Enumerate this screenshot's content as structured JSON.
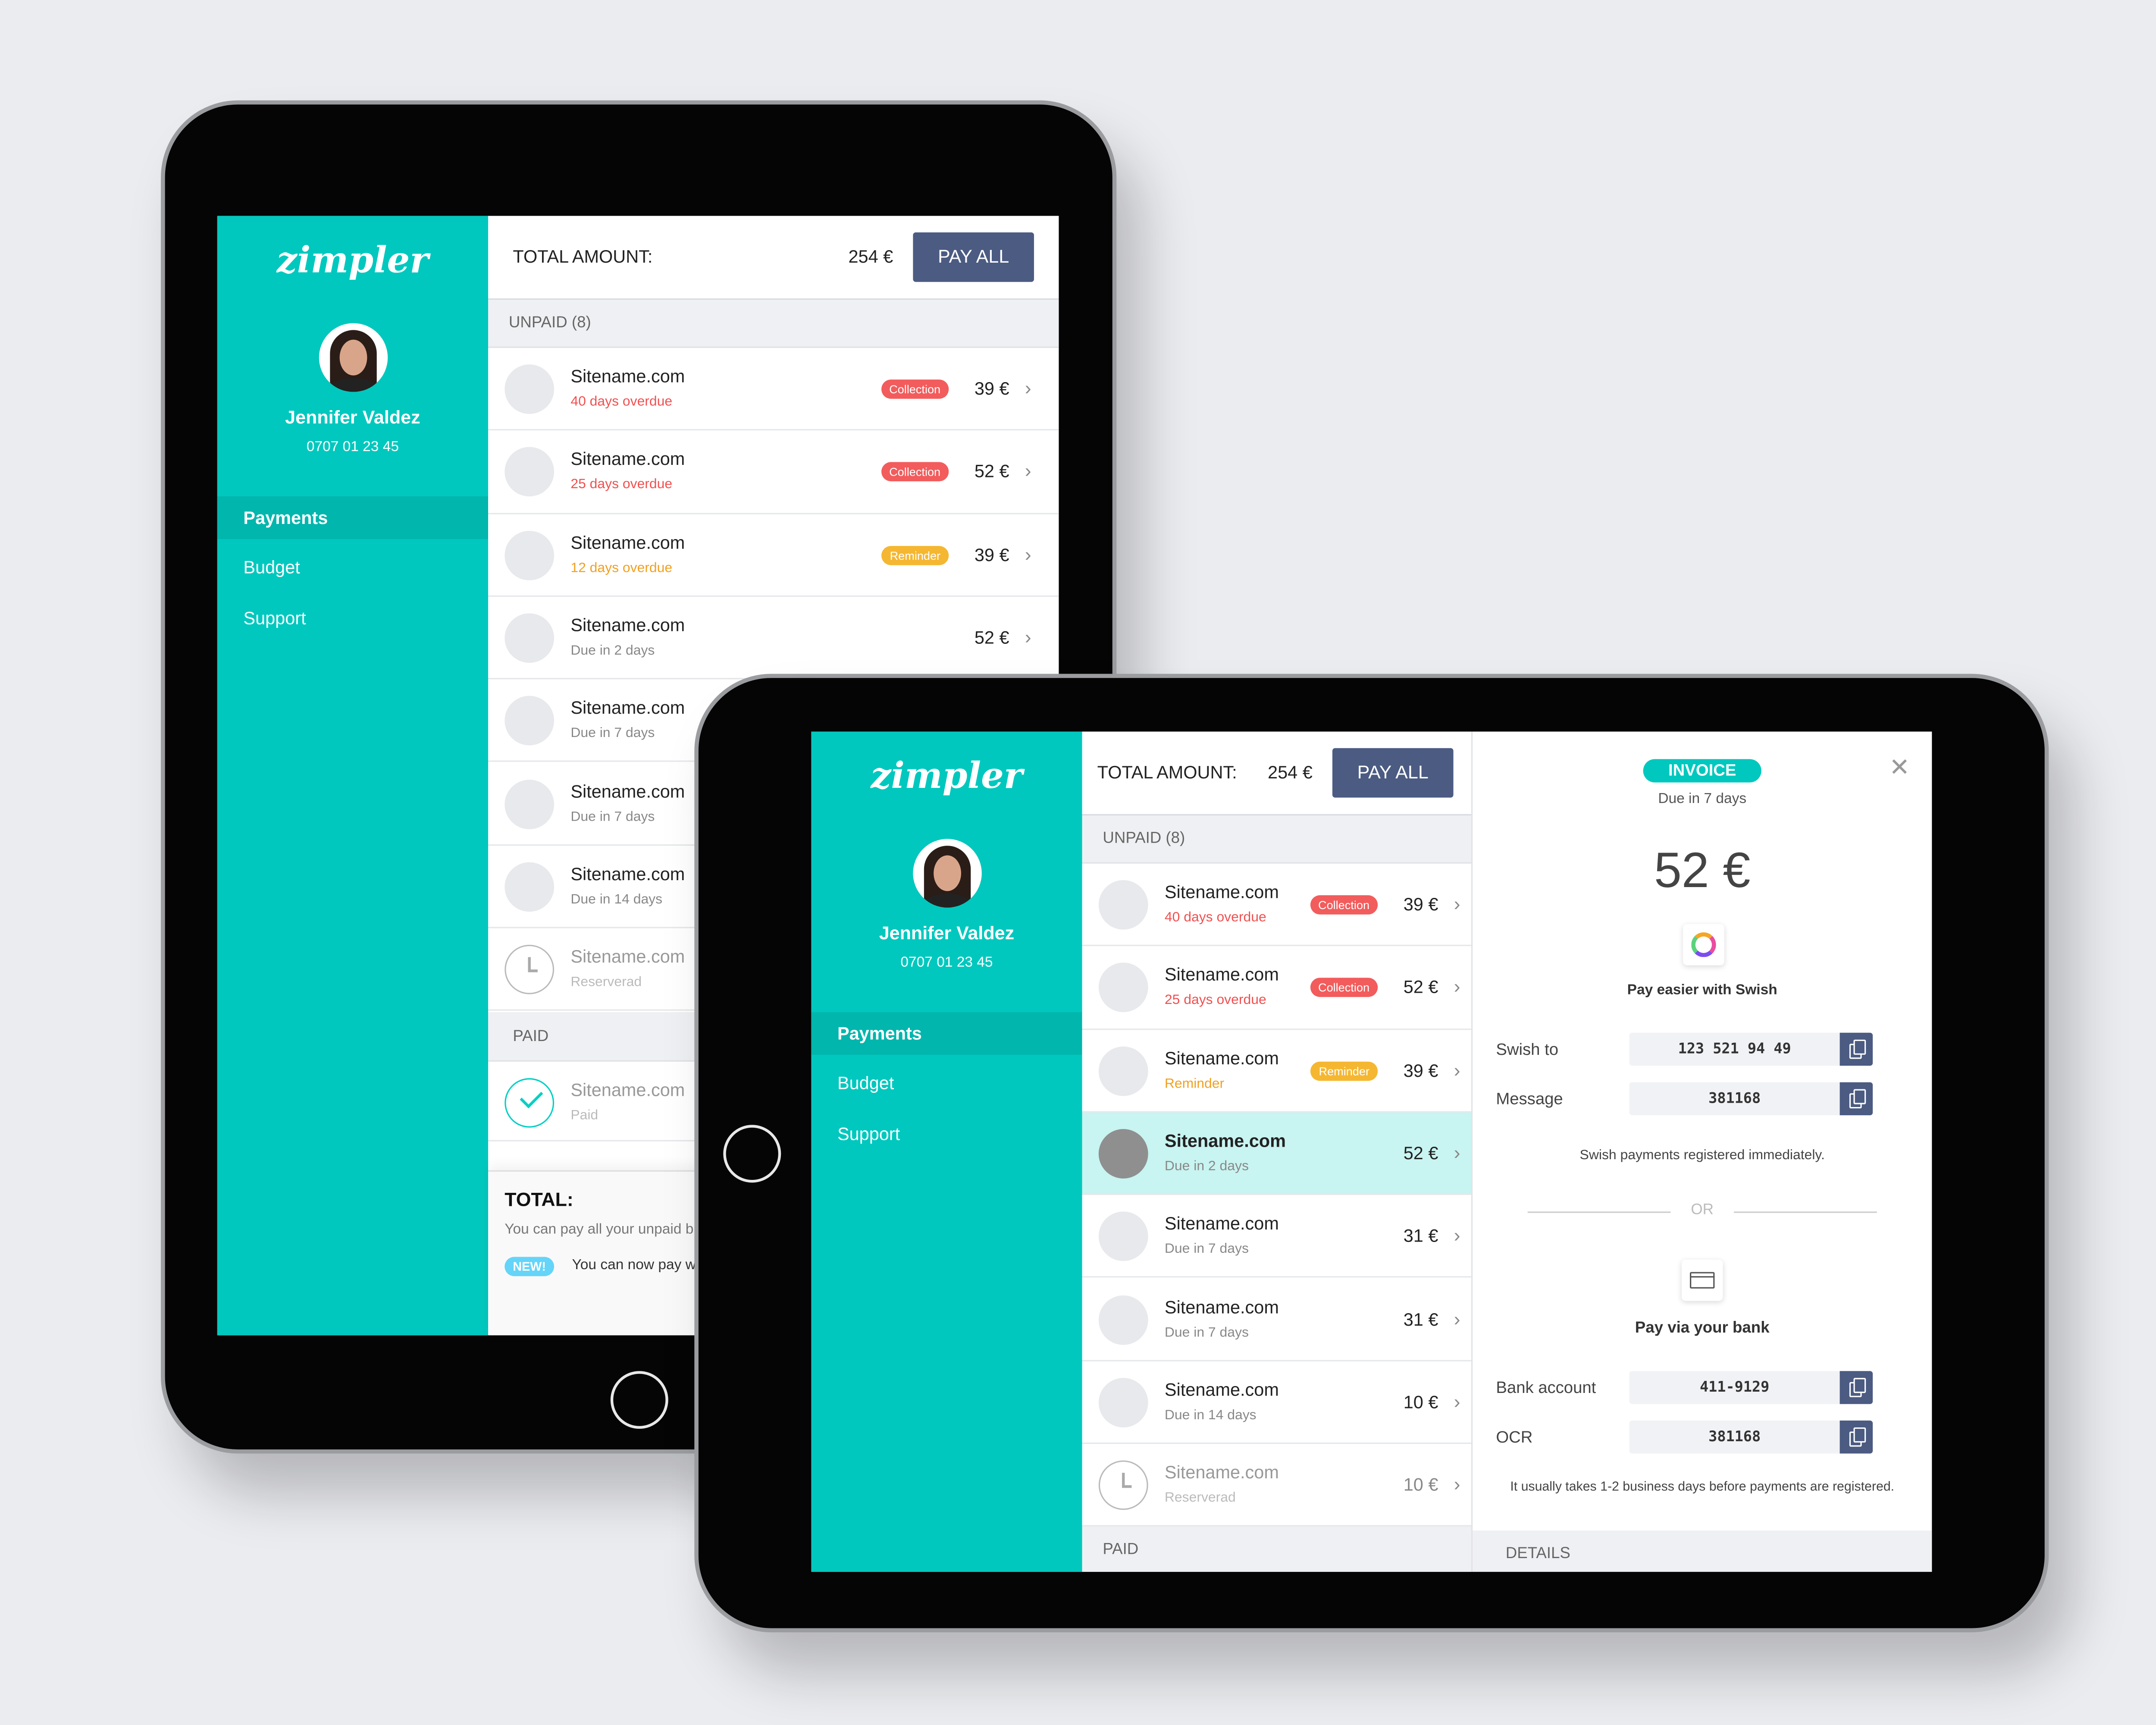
{
  "brand": {
    "logo": "zimpler",
    "accent": "#00c8be",
    "button": "#4b5b82",
    "collection": "#f25c5c",
    "reminder": "#f5b731"
  },
  "user": {
    "name": "Jennifer Valdez",
    "phone": "0707 01 23 45"
  },
  "nav": [
    {
      "label": "Payments",
      "active": true
    },
    {
      "label": "Budget"
    },
    {
      "label": "Support"
    }
  ],
  "header": {
    "total_label": "TOTAL AMOUNT:",
    "total_value": "254 €",
    "pay_all": "PAY ALL"
  },
  "sections": {
    "unpaid": "UNPAID (8)",
    "paid": "PAID"
  },
  "back_tablet": {
    "unpaid": [
      {
        "site": "Sitename.com",
        "sub": "40 days overdue",
        "sub_color": "red",
        "badge": "Collection",
        "badge_color": "red",
        "amount": "39 €",
        "icon": "avatar"
      },
      {
        "site": "Sitename.com",
        "sub": "25 days overdue",
        "sub_color": "red",
        "badge": "Collection",
        "badge_color": "red",
        "amount": "52 €",
        "icon": "avatar"
      },
      {
        "site": "Sitename.com",
        "sub": "12 days overdue",
        "sub_color": "orange",
        "badge": "Reminder",
        "badge_color": "orange",
        "amount": "39 €",
        "icon": "avatar"
      },
      {
        "site": "Sitename.com",
        "sub": "Due in 2 days",
        "amount": "52 €",
        "icon": "avatar"
      },
      {
        "site": "Sitename.com",
        "sub": "Due in 7 days",
        "icon": "avatar"
      },
      {
        "site": "Sitename.com",
        "sub": "Due in 7 days",
        "icon": "avatar"
      },
      {
        "site": "Sitename.com",
        "sub": "Due in 14 days",
        "icon": "avatar"
      },
      {
        "site": "Sitename.com",
        "sub": "Reserverad",
        "icon": "clock",
        "muted": true
      }
    ],
    "paid": [
      {
        "site": "Sitename.com",
        "sub": "Paid",
        "sub_color": "teal",
        "icon": "check",
        "muted": true
      }
    ],
    "footer": {
      "title": "TOTAL:",
      "text": "You can pay all your unpaid bil",
      "new_badge": "NEW!",
      "new_text": "You can now pay wi"
    }
  },
  "front_tablet": {
    "unpaid": [
      {
        "site": "Sitename.com",
        "sub": "40 days overdue",
        "sub_color": "red",
        "badge": "Collection",
        "badge_color": "red",
        "amount": "39 €",
        "icon": "avatar"
      },
      {
        "site": "Sitename.com",
        "sub": "25 days overdue",
        "sub_color": "red",
        "badge": "Collection",
        "badge_color": "red",
        "amount": "52 €",
        "icon": "avatar"
      },
      {
        "site": "Sitename.com",
        "sub": "Reminder",
        "sub_color": "orange",
        "badge": "Reminder",
        "badge_color": "orange",
        "amount": "39 €",
        "icon": "avatar"
      },
      {
        "site": "Sitename.com",
        "sub": "Due in 2 days",
        "amount": "52 €",
        "icon": "avatar",
        "selected": true
      },
      {
        "site": "Sitename.com",
        "sub": "Due in 7 days",
        "amount": "31 €",
        "icon": "avatar"
      },
      {
        "site": "Sitename.com",
        "sub": "Due in 7 days",
        "amount": "31 €",
        "icon": "avatar"
      },
      {
        "site": "Sitename.com",
        "sub": "Due in 14 days",
        "amount": "10 €",
        "icon": "avatar"
      },
      {
        "site": "Sitename.com",
        "sub": "Reserverad",
        "amount": "10 €",
        "icon": "clock",
        "muted": true
      }
    ],
    "detail": {
      "tag": "INVOICE",
      "due": "Due in 7 days",
      "amount": "52 €",
      "swish_title": "Pay easier with Swish",
      "swish_to_label": "Swish to",
      "swish_to_value": "123 521 94 49",
      "message_label": "Message",
      "message_value": "381168",
      "swish_note": "Swish payments registered immediately.",
      "or": "OR",
      "bank_title": "Pay via your bank",
      "bank_account_label": "Bank account",
      "bank_account_value": "411-9129",
      "ocr_label": "OCR",
      "ocr_value": "381168",
      "bank_note": "It usually takes 1-2 business days before payments are registered.",
      "details": "DETAILS"
    }
  }
}
